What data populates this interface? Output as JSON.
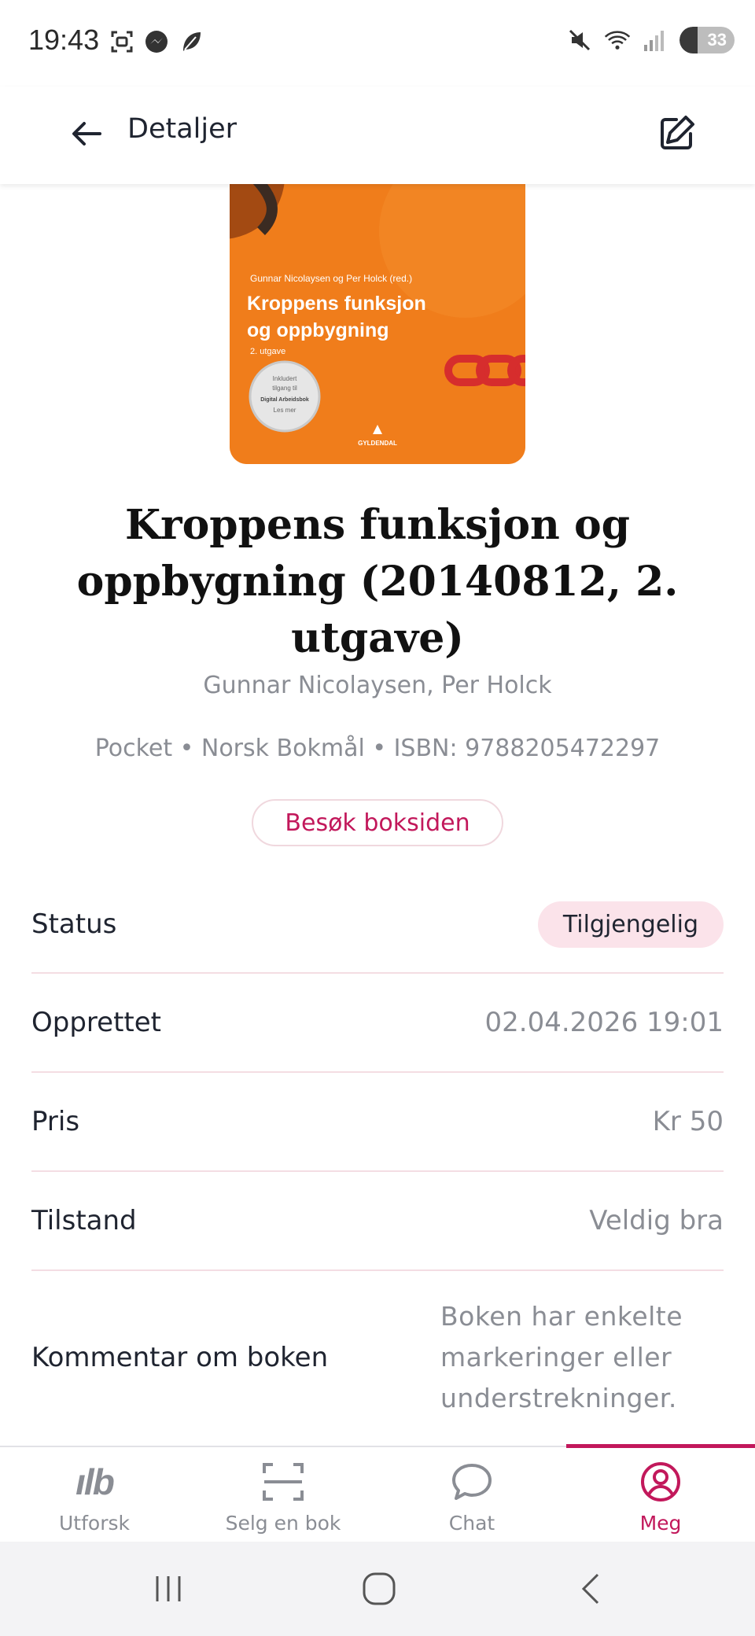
{
  "status_bar": {
    "time": "19:43",
    "battery_level": "33",
    "battery_fraction": 0.33,
    "left_icons": [
      "screenshot-icon",
      "messenger-icon",
      "leaf-icon"
    ],
    "right_icons": [
      "mute-icon",
      "wifi-icon",
      "signal-icon"
    ]
  },
  "header": {
    "title": "Detaljer",
    "back_icon": "arrow-left-icon",
    "edit_icon": "edit-icon"
  },
  "book": {
    "cover": {
      "editors": "Gunnar Nicolaysen og Per Holck (red.)",
      "title_line1": "Kroppens funksjon",
      "title_line2": "og oppbygning",
      "edition": "2. utgave",
      "badge_line1": "Inkludert",
      "badge_line2": "tilgang til",
      "badge_line3": "Digital Arbeidsbok",
      "badge_line4": "Les mer",
      "publisher": "GYLDENDAL",
      "background_color": "#f07d1b"
    },
    "title": "Kroppens funksjon og oppbygning (20140812, 2. utgave)",
    "authors": "Gunnar Nicolaysen, Per Holck",
    "meta": "Pocket • Norsk Bokmål • ISBN: 9788205472297",
    "visit_button": "Besøk boksiden"
  },
  "details": {
    "status_label": "Status",
    "status_value": "Tilgjengelig",
    "created_label": "Opprettet",
    "created_value": "02.04.2026 19:01",
    "price_label": "Pris",
    "price_value": "Kr 50",
    "condition_label": "Tilstand",
    "condition_value": "Veldig bra",
    "comment_label": "Kommentar om boken",
    "comment_value": "Boken har enkelte markeringer eller understrekninger."
  },
  "bottom_nav": {
    "items": [
      {
        "label": "Utforsk",
        "icon": "lb-logo-icon"
      },
      {
        "label": "Selg en bok",
        "icon": "scan-icon"
      },
      {
        "label": "Chat",
        "icon": "chat-bubble-icon"
      },
      {
        "label": "Meg",
        "icon": "profile-icon"
      }
    ],
    "active_index": 3
  },
  "colors": {
    "accent": "#c2185b",
    "pill_bg": "#fbe3ea",
    "divider": "#f4dde3",
    "muted_text": "#8a8d94"
  }
}
